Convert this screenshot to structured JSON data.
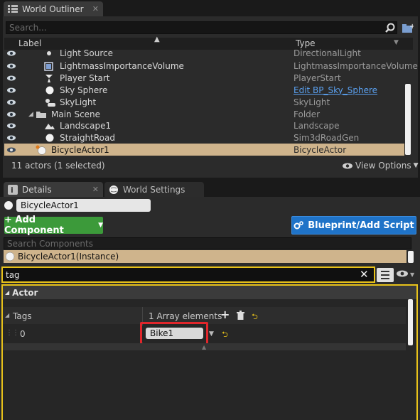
{
  "outliner": {
    "tab_title": "World Outliner",
    "search_placeholder": "Search...",
    "col_label": "Label",
    "col_type": "Type",
    "rows": [
      {
        "label": "Light Source",
        "type": "DirectionalLight"
      },
      {
        "label": "LightmassImportanceVolume",
        "type": "LightmassImportanceVolume"
      },
      {
        "label": "Player Start",
        "type": "PlayerStart"
      },
      {
        "label": "Sky Sphere",
        "type": "Edit BP_Sky_Sphere"
      },
      {
        "label": "SkyLight",
        "type": "SkyLight"
      },
      {
        "label": "Main Scene",
        "type": "Folder"
      },
      {
        "label": "Landscape1",
        "type": "Landscape"
      },
      {
        "label": "StraightRoad",
        "type": "Sim3dRoadGen"
      },
      {
        "label": "BicycleActor1",
        "type": "BicycleActor"
      }
    ],
    "status": "11 actors (1 selected)",
    "view_options": "View Options"
  },
  "details": {
    "tab_title": "Details",
    "world_settings_tab": "World Settings",
    "actor_name": "BicycleActor1",
    "add_component": "+ Add Component",
    "blueprint": "Blueprint/Add Script",
    "search_components_placeholder": "Search Components",
    "instance_label": "BicycleActor1(Instance)",
    "property_search": "tag",
    "category": "Actor",
    "tags_label": "Tags",
    "array_elements": "1 Array elements",
    "index_label": "0",
    "tag_value": "Bike1"
  },
  "colors": {
    "selection": "#cfb48c",
    "green_button": "#3c9a3a",
    "blue_button": "#1f73c8",
    "highlight_border": "#e8c21a",
    "annotation_red": "#e0262b"
  }
}
